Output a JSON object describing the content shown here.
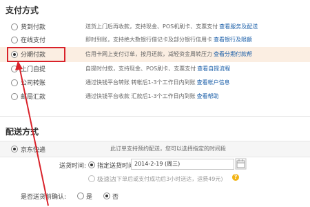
{
  "payment": {
    "title": "支付方式",
    "options": [
      {
        "label": "货到付款",
        "desc": "送货上门后再收款，支持现金、POS机刷卡、支票支付",
        "link": "查看服务及配送"
      },
      {
        "label": "在线支付",
        "desc": "即时到账，支持绝大数银行借记卡及部分银行信用卡",
        "link": "查看银行及限额"
      },
      {
        "label": "分期付款",
        "desc": "信用卡网上支付订单，按月还款，减轻资金周转压力",
        "link": "查看分期付款帮"
      },
      {
        "label": "上门自提",
        "desc": "自提时付款，支持现金、POS刷卡、支票支付",
        "link": "查看自提流程"
      },
      {
        "label": "公司转账",
        "desc": "通过快钱平台转账 转帐后1-3个工作日内到账",
        "link": "查看帐户信息"
      },
      {
        "label": "邮局汇款",
        "desc": "通过快钱平台收款 汇款后1-3个工作日内到账",
        "link": "查看帮助"
      }
    ],
    "selected_index": 2
  },
  "shipping": {
    "title": "配送方式",
    "carrier_label": "京东快递",
    "carrier_desc": "此订单支持预约配送，您可以选择指定的时间段",
    "time_label": "送货时间:",
    "time_option1": "指定送货时间",
    "date_value": "2014-2-19 (周三)",
    "time_option2": "极速达",
    "time_option2_note": "(下单后或支付成功后3小时送达，运费49元)",
    "confirm_label": "是否送货前确认:",
    "confirm_yes": "是",
    "confirm_no": "否"
  },
  "colors": {
    "highlight": "#d9222a",
    "link": "#1a5ea8"
  }
}
